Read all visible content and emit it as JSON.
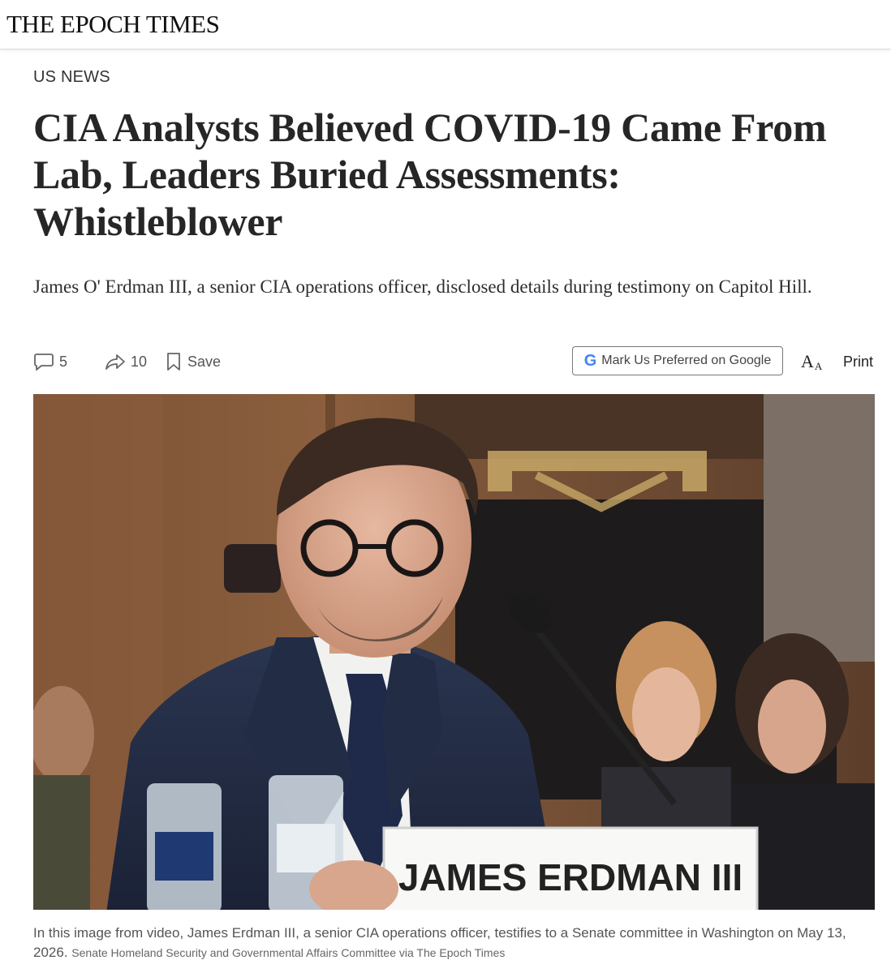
{
  "masthead": {
    "logo": "THE EPOCH TIMES"
  },
  "article": {
    "section": "US NEWS",
    "headline": "CIA Analysts Believed COVID-19 Came From Lab, Leaders Buried Assessments: Whistleblower",
    "subhead": "James O' Erdman III, a senior CIA operations officer, disclosed details during testimony on Capitol Hill."
  },
  "actions": {
    "comments_count": "5",
    "shares_count": "10",
    "save_label": "Save",
    "google_label": "Mark Us Preferred on Google",
    "google_g": "G",
    "fontsize_big": "A",
    "fontsize_small": "A",
    "print_label": "Print"
  },
  "photo": {
    "nameplate": "JAMES ERDMAN III"
  },
  "caption": {
    "text": "In this image from video, James Erdman III, a senior CIA operations officer, testifies to a Senate committee in Washington on May 13, 2026.",
    "credit": "Senate Homeland Security and Governmental Affairs Committee via The Epoch Times"
  }
}
